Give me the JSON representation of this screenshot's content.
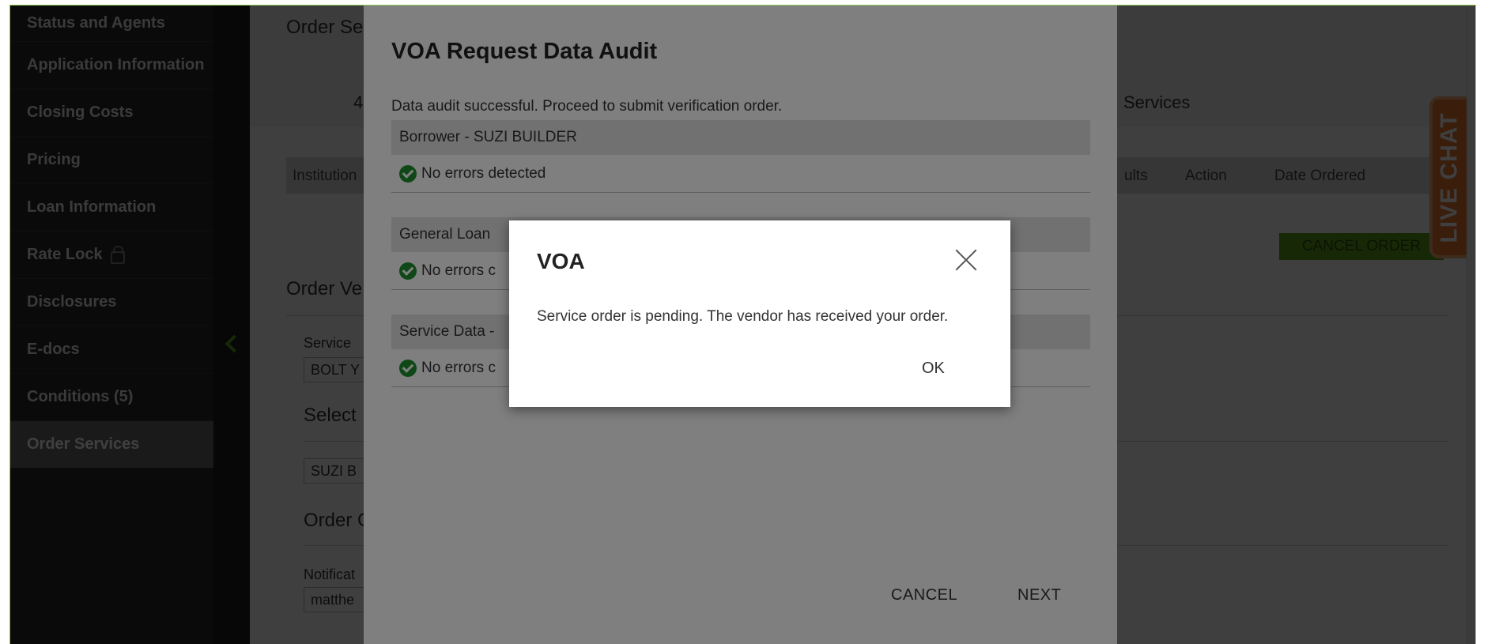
{
  "sidebar": {
    "items": [
      {
        "label": "Status and Agents"
      },
      {
        "label": "Application Information"
      },
      {
        "label": "Closing Costs"
      },
      {
        "label": "Pricing"
      },
      {
        "label": "Loan Information"
      },
      {
        "label": "Rate Lock"
      },
      {
        "label": "Disclosures"
      },
      {
        "label": "E-docs"
      },
      {
        "label": "Conditions (5)"
      },
      {
        "label": "Order Services"
      }
    ],
    "active": "Order Services"
  },
  "background": {
    "page_title": "Order Se",
    "tab_number": "4",
    "tab_services": "Services",
    "table_columns": [
      "Institution",
      "ults",
      "Action",
      "Date Ordered"
    ],
    "cancel_order": "CANCEL ORDER",
    "order_verification": "Order Ve",
    "service_label": "Service",
    "service_value": "BOLT Y",
    "select_label": "Select",
    "borrower_value": "SUZI B",
    "order_c_label": "Order C",
    "notification_label": "Notificat",
    "notification_value": "matthe"
  },
  "live_chat": {
    "label": "LIVE CHAT"
  },
  "audit_modal": {
    "title": "VOA Request Data Audit",
    "message": "Data audit successful. Proceed to submit verification order.",
    "sections": [
      {
        "header": "Borrower - SUZI BUILDER",
        "status": "No errors detected"
      },
      {
        "header": "General Loan",
        "status": "No errors c"
      },
      {
        "header": "Service Data -",
        "status": "No errors c"
      }
    ],
    "cancel_label": "CANCEL",
    "next_label": "NEXT"
  },
  "alert": {
    "title": "VOA",
    "message": "Service order is pending. The vendor has received your order.",
    "ok_label": "OK"
  },
  "colors": {
    "accent_green": "#5ea21a",
    "check_green": "#1f8f2e",
    "live_chat_orange": "#e8742c",
    "sidebar_bg": "#292929"
  }
}
